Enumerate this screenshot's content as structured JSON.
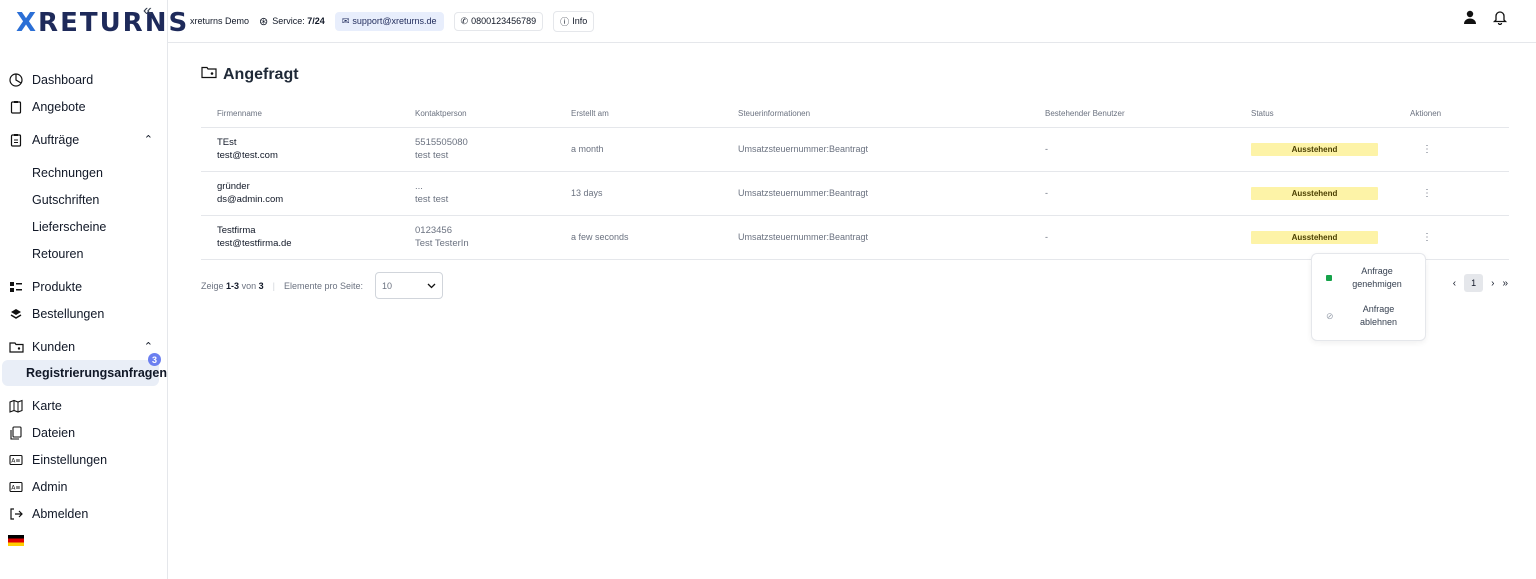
{
  "brand": {
    "x": "X",
    "rest": "RETURNS"
  },
  "sidebar": {
    "collapse": "«",
    "items": [
      {
        "label": "Dashboard"
      },
      {
        "label": "Angebote"
      },
      {
        "label": "Aufträge"
      },
      {
        "label": "Rechnungen"
      },
      {
        "label": "Gutschriften"
      },
      {
        "label": "Lieferscheine"
      },
      {
        "label": "Retouren"
      },
      {
        "label": "Produkte"
      },
      {
        "label": "Bestellungen"
      },
      {
        "label": "Kunden"
      },
      {
        "label": "Registrierungsanfragen",
        "badge": "3"
      },
      {
        "label": "Karte"
      },
      {
        "label": "Dateien"
      },
      {
        "label": "Einstellungen"
      },
      {
        "label": "Admin"
      },
      {
        "label": "Abmelden"
      }
    ]
  },
  "topbar": {
    "company": "xreturns Demo",
    "service_label": "Service:",
    "service_value": "7/24",
    "email": "support@xreturns.de",
    "phone": "0800123456789",
    "info": "Info"
  },
  "page": {
    "title": "Angefragt"
  },
  "table": {
    "headers": [
      "Firmenname",
      "Kontaktperson",
      "Erstellt am",
      "Steuerinformationen",
      "Bestehender Benutzer",
      "Status",
      "Aktionen"
    ],
    "rows": [
      {
        "firm": "TEst",
        "email": "test@test.com",
        "contact1": "5515505080",
        "contact2": "test test",
        "created": "a month",
        "tax": "Umsatzsteuernummer:Beantragt",
        "user": "-",
        "status": "Ausstehend",
        "action": "⋮"
      },
      {
        "firm": "gründer",
        "email": "ds@admin.com",
        "contact1": "...",
        "contact2": "test test",
        "created": "13 days",
        "tax": "Umsatzsteuernummer:Beantragt",
        "user": "-",
        "status": "Ausstehend",
        "action": "⋮"
      },
      {
        "firm": "Testfirma",
        "email": "test@testfirma.de",
        "contact1": "0123456",
        "contact2": "Test TesterIn",
        "created": "a few seconds",
        "tax": "Umsatzsteuernummer:Beantragt",
        "user": "-",
        "status": "Ausstehend",
        "action": "⋮"
      }
    ]
  },
  "pager": {
    "prefix": "Zeige",
    "range": "1-3",
    "of": "von",
    "total": "3",
    "per_page_label": "Elemente pro Seite:",
    "per_page_value": "10",
    "current_page": "1"
  },
  "menu": {
    "approve": "Anfrage genehmigen",
    "reject": "Anfrage ablehnen"
  }
}
